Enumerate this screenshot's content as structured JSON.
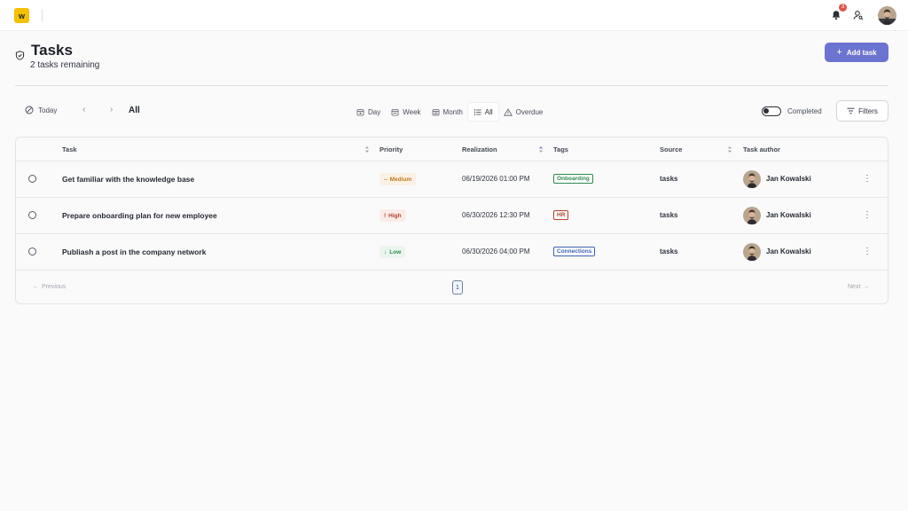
{
  "topbar": {
    "logo_letter": "w",
    "notifications_count": "3",
    "icons": [
      "bell-icon",
      "user-search-icon"
    ]
  },
  "header": {
    "title": "Tasks",
    "subtitle": "2 tasks remaining",
    "add_label": "Add task",
    "add_icon": "+"
  },
  "toolbar": {
    "today_label": "Today",
    "prev_glyph": "‹",
    "next_glyph": "›",
    "range_label": "All",
    "views": [
      "Day",
      "Week",
      "Month",
      "All",
      "Overdue"
    ],
    "active_view": "All",
    "completed_label": "Completed",
    "completed_on": false,
    "filters_label": "Filters"
  },
  "table": {
    "columns": [
      "Task",
      "Priority",
      "Realization",
      "Tags",
      "Source",
      "Task author"
    ],
    "rows": [
      {
        "task": "Get familiar with the knowledge base",
        "priority": "Medium",
        "priority_glyph": "–",
        "realization": "06/19/2026 01:00 PM",
        "tag": "Onboarding",
        "source": "tasks",
        "author": "Jan Kowalski"
      },
      {
        "task": "Prepare onboarding plan for new employee",
        "priority": "High",
        "priority_glyph": "!",
        "realization": "06/30/2026 12:30 PM",
        "tag": "HR",
        "source": "tasks",
        "author": "Jan Kowalski"
      },
      {
        "task": "Publiash a post in the company network",
        "priority": "Low",
        "priority_glyph": "↓",
        "realization": "06/30/2026 04:00 PM",
        "tag": "Connections",
        "source": "tasks",
        "author": "Jan Kowalski"
      }
    ]
  },
  "pagination": {
    "previous_label": "Previous",
    "next_label": "Next",
    "current_page": "1"
  },
  "colors": {
    "accent": "#6c74d1",
    "logo": "#f5c000",
    "badge": "#e05545",
    "priority_medium": "#c07a1a",
    "priority_high": "#b5402a",
    "priority_low": "#2e8a4e",
    "tag_onboarding": "#2e8a4e",
    "tag_hr": "#b5402a",
    "tag_connections": "#3b62b6"
  }
}
